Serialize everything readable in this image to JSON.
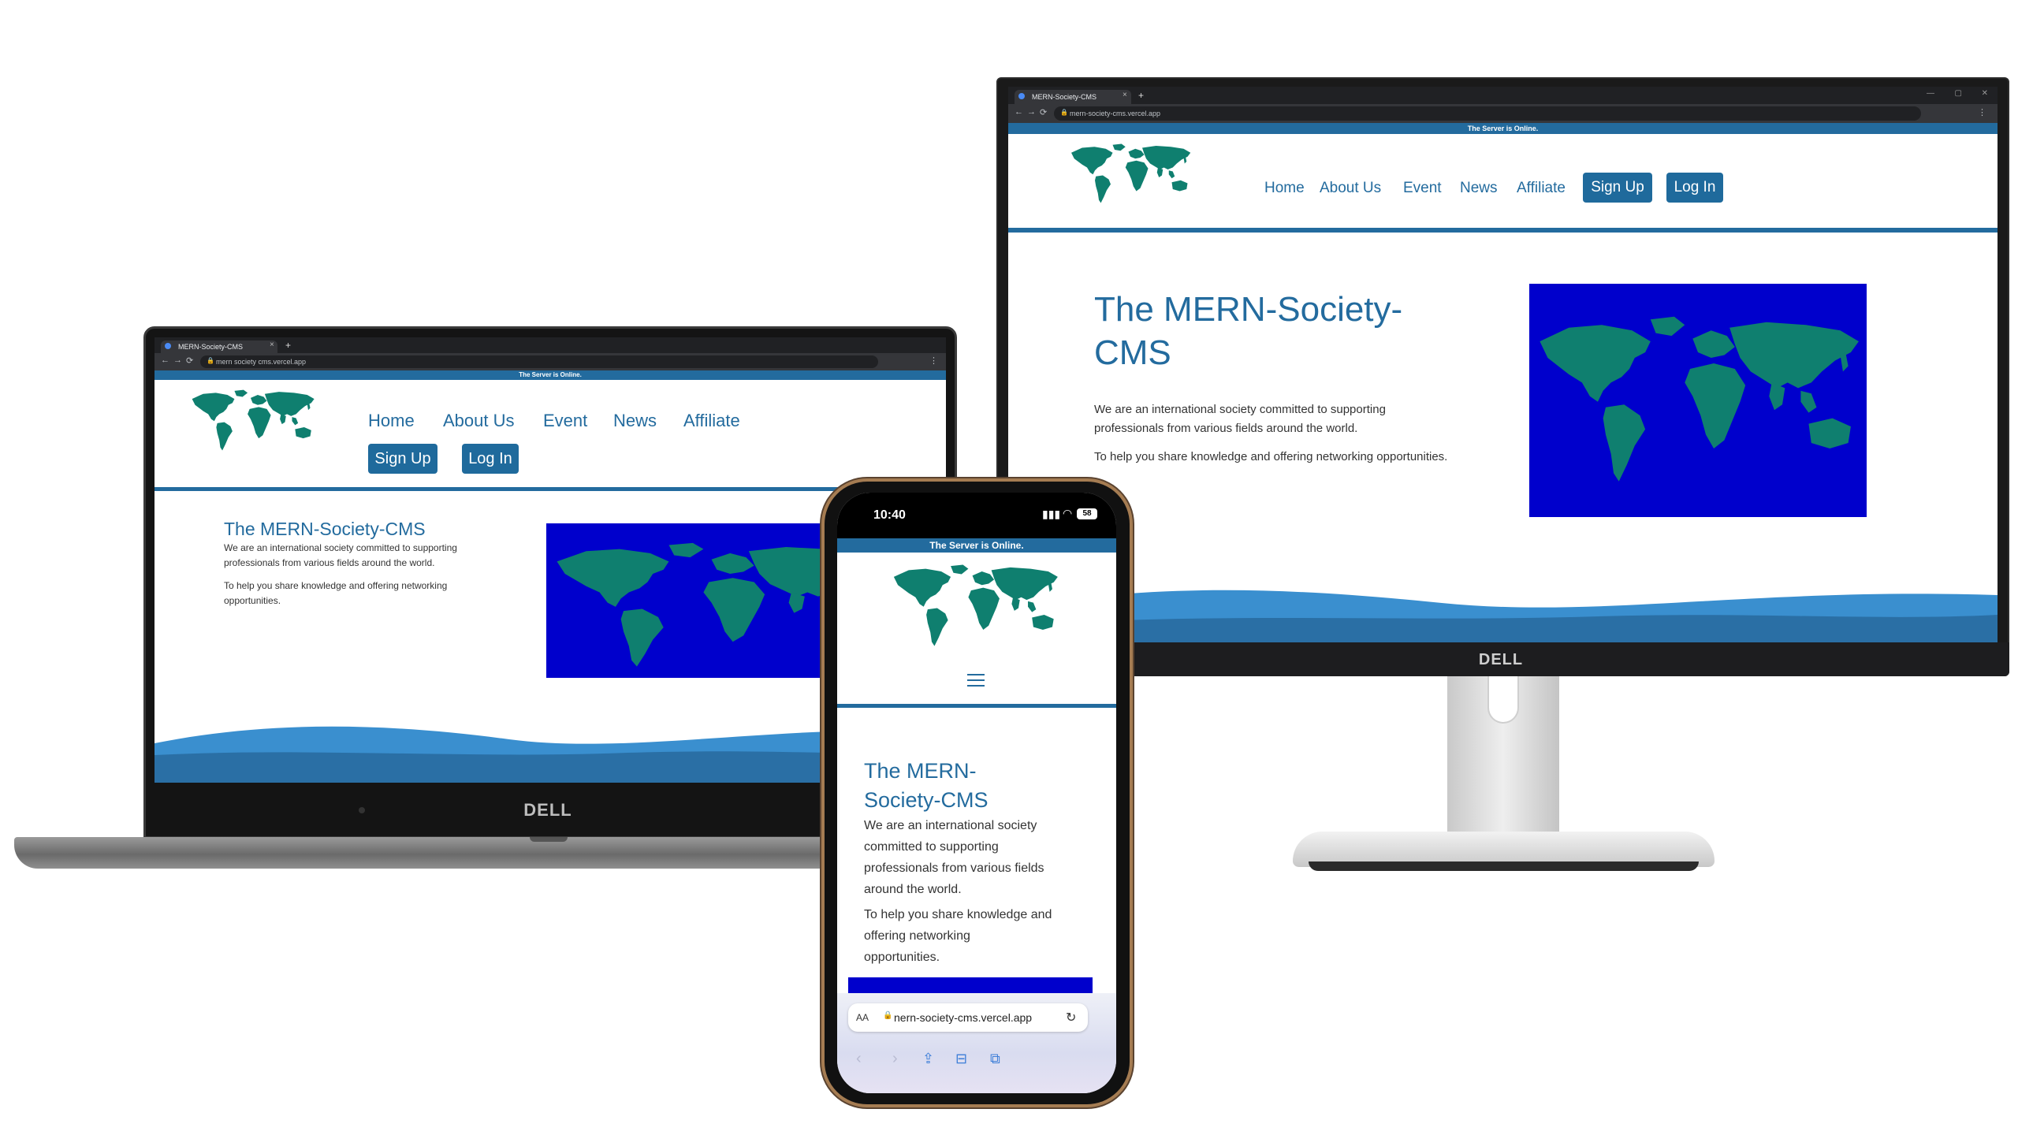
{
  "site": {
    "tab_title": "MERN-Society-CMS",
    "url": "mern-society-cms.vercel.app",
    "server_status": "The Server is Online.",
    "nav": [
      "Home",
      "About Us",
      "Event",
      "News",
      "Affiliate"
    ],
    "signup_label": "Sign Up",
    "login_label": "Log In",
    "hero_title": "The MERN-Society-CMS",
    "hero_title_line1": "The MERN-Society-",
    "hero_title_line2": "CMS",
    "hero_p1": "We are an international society committed to supporting professionals from various fields around the world.",
    "hero_p2": "To help you share knowledge and offering networking opportunities."
  },
  "laptop": {
    "brand": "DELL",
    "url_display": "mern society cms.vercel.app",
    "hero_p1_line1": "We are an international society committed to supporting",
    "hero_p1_line2": "professionals from various fields around the world.",
    "hero_p2_line1": "To help you share knowledge and offering networking",
    "hero_p2_line2": "opportunities."
  },
  "monitor": {
    "brand": "DELL",
    "hero_p1_line1": "We are an international society committed to supporting",
    "hero_p1_line2": "professionals from various fields around the world."
  },
  "phone": {
    "time": "10:40",
    "battery": "58",
    "aa_label": "AA",
    "url_display": "nern-society-cms.vercel.app",
    "hero_title_line1": "The MERN-",
    "hero_title_line2": "Society-CMS",
    "hero_p1_lines": [
      "We are an international society",
      "committed to supporting",
      "professionals from various fields",
      "around the world."
    ],
    "hero_p2_lines": [
      "To help you share knowledge and",
      "offering networking",
      "opportunities."
    ]
  },
  "colors": {
    "brand_blue": "#236b9e",
    "map_bg": "#0000cc",
    "land": "#0f7f6f",
    "wave_light": "#3a8fcf",
    "wave_dark": "#2a6fa5"
  },
  "icons": [
    "lock-icon",
    "back-arrow-icon",
    "forward-arrow-icon",
    "reload-icon",
    "hamburger-menu-icon",
    "share-icon",
    "bookmarks-icon",
    "tabs-icon",
    "signal-icon",
    "wifi-icon",
    "battery-icon",
    "world-map-logo"
  ]
}
